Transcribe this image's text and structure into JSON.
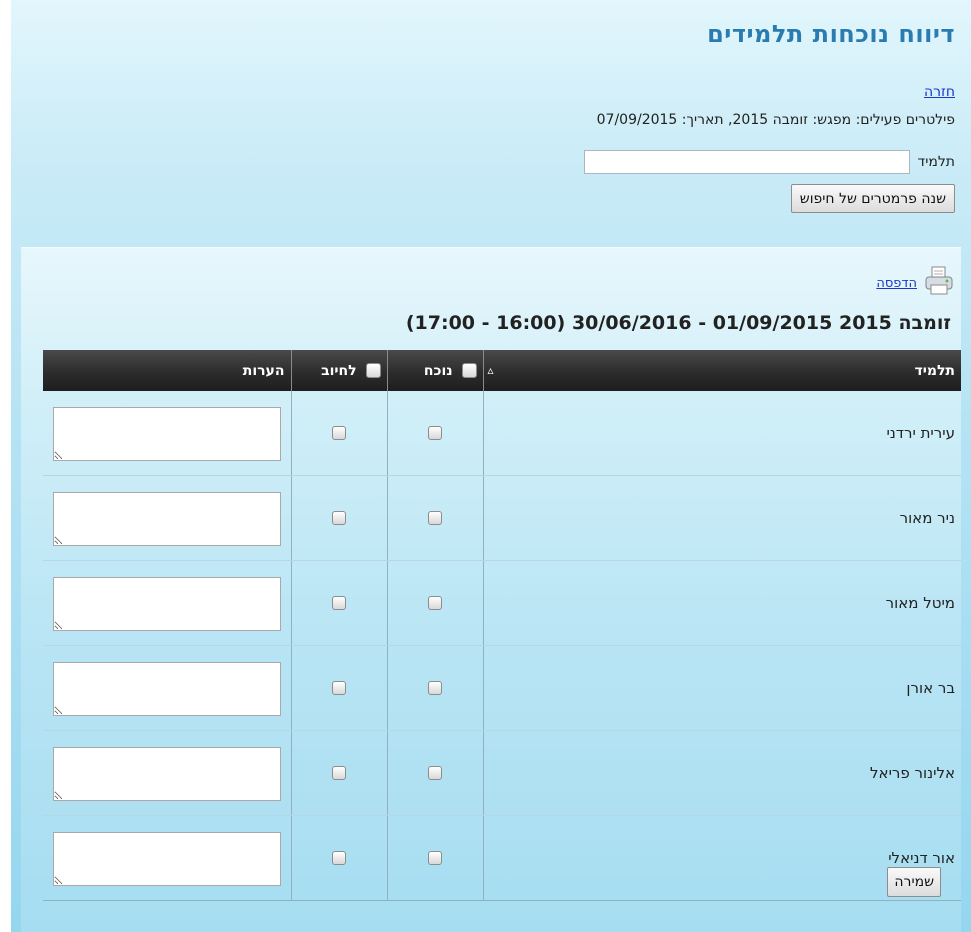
{
  "header": {
    "title": "דיווח נוכחות תלמידים",
    "back_label": "חזרה",
    "filters_text": "פילטרים פעילים: מפגש: זומבה 2015, תאריך: 07/09/2015",
    "student_label": "תלמיד",
    "student_value": "",
    "change_button": "שנה פרמטרים של חיפוש"
  },
  "results": {
    "print_label": "הדפסה",
    "session_title": "זומבה 2015 01/09/2015 - 30/06/2016 (16:00 - 17:00)",
    "columns": {
      "student": "תלמיד",
      "sort_indicator": "▵",
      "present": "נוכח",
      "charge": "לחיוב",
      "notes": "הערות"
    },
    "students": [
      "עירית ירדני",
      "ניר מאור",
      "מיטל מאור",
      "בר אורן",
      "אלינור פריאל",
      "אור דניאלי"
    ],
    "save_button": "שמירה"
  },
  "icons": {
    "printer": "printer-icon",
    "checkbox": "checkbox"
  }
}
